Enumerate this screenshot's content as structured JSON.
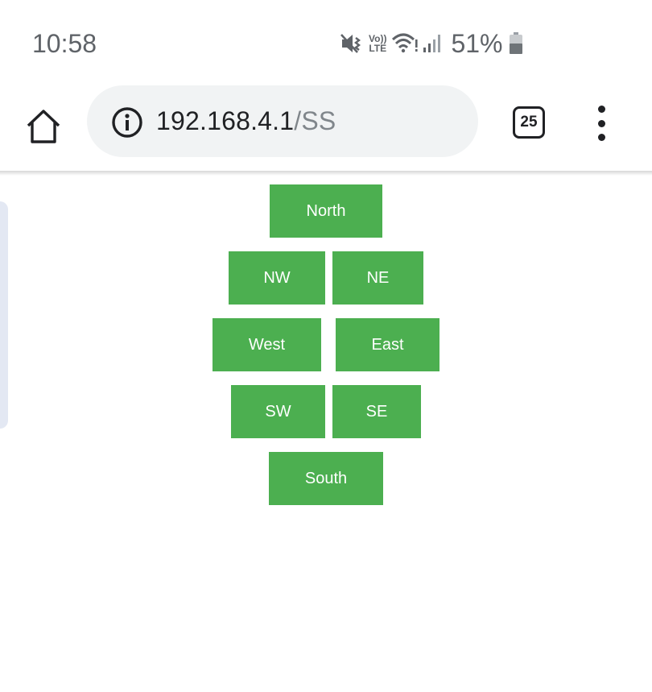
{
  "status_bar": {
    "time": "10:58",
    "volte_line1": "Vo))",
    "volte_line2": "LTE",
    "battery_percent": "51%"
  },
  "browser": {
    "url_host": "192.168.4.1",
    "url_path": "/SS",
    "tab_count": "25"
  },
  "controls": {
    "north": "North",
    "nw": "NW",
    "ne": "NE",
    "west": "West",
    "east": "East",
    "sw": "SW",
    "se": "SE",
    "south": "South"
  },
  "colors": {
    "button_bg": "#4caf50",
    "button_text": "#ffffff",
    "url_bar_bg": "#f1f3f4"
  },
  "icons": [
    "mute-vibrate-icon",
    "volte-icon",
    "wifi-icon",
    "signal-icon",
    "battery-icon",
    "home-icon",
    "info-icon",
    "tabs-icon",
    "more-menu-icon"
  ]
}
